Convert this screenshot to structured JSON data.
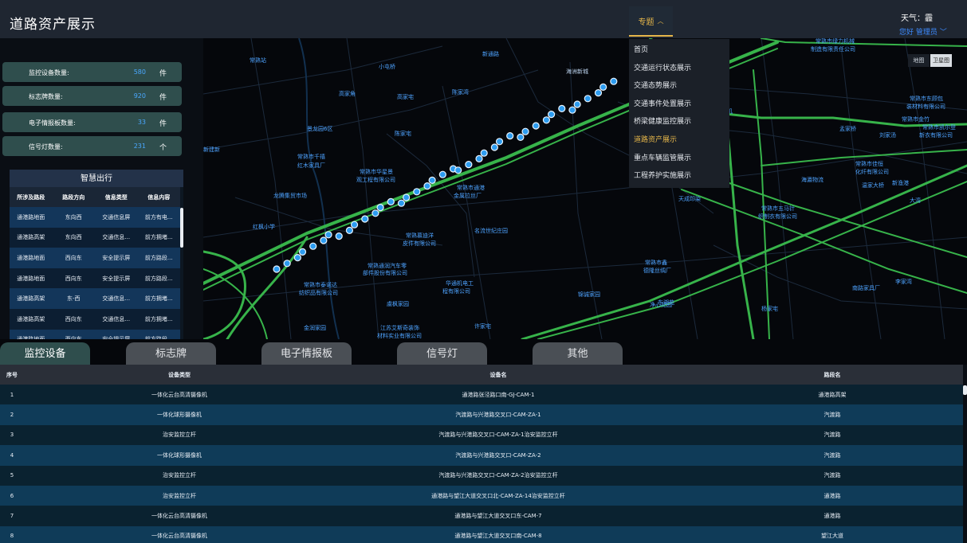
{
  "header": {
    "title": "道路资产展示",
    "menu_label": "专题",
    "weather": "天气：霾",
    "user": "您好 管理员"
  },
  "menu": {
    "items": [
      "首页",
      "交通运行状态展示",
      "交通态势展示",
      "交通事件处置展示",
      "桥梁健康监控展示",
      "道路资产展示",
      "重点车辆监管展示",
      "工程养护实施展示"
    ],
    "active_index": 5,
    "active_color": "#e5b64a"
  },
  "map": {
    "toggle": [
      "地图",
      "卫星图"
    ],
    "labels": [
      {
        "text": "常熟站",
        "c": "b"
      },
      {
        "text": "小屯桥",
        "c": "b"
      },
      {
        "text": "高家角",
        "c": "b"
      },
      {
        "text": "高家宅",
        "c": "b"
      },
      {
        "text": "陈家湾",
        "c": "b"
      },
      {
        "text": "海洲新城",
        "c": "w"
      },
      {
        "text": "常熟市绿力机械",
        "c": "b"
      },
      {
        "text": "制造有限责任公司",
        "c": "b"
      },
      {
        "text": "常熟市东顾包",
        "c": "b"
      },
      {
        "text": "装材料有限公司",
        "c": "b"
      },
      {
        "text": "常熟市凯尔登",
        "c": "b"
      },
      {
        "text": "新衣有限公司",
        "c": "b"
      },
      {
        "text": "海瀛电机",
        "c": "b"
      },
      {
        "text": "景龙园6区",
        "c": "b"
      },
      {
        "text": "常熟市千禧",
        "c": "b"
      },
      {
        "text": "红木家具厂",
        "c": "b"
      },
      {
        "text": "常熟市华星景",
        "c": "b"
      },
      {
        "text": "观工程有限公司",
        "c": "b"
      },
      {
        "text": "常熟市通港",
        "c": "b"
      },
      {
        "text": "金属拉丝厂",
        "c": "b"
      },
      {
        "text": "龙腾集贸市场",
        "c": "b"
      },
      {
        "text": "红枫小学",
        "c": "b"
      },
      {
        "text": "常熟慕迪洋",
        "c": "b"
      },
      {
        "text": "皮件有限公司",
        "c": "b"
      },
      {
        "text": "名流世纪庄园",
        "c": "b"
      },
      {
        "text": "常熟通润汽车零",
        "c": "b"
      },
      {
        "text": "部件股份有限公司",
        "c": "b"
      },
      {
        "text": "常熟市泰诺达",
        "c": "b"
      },
      {
        "text": "纺织品有限公司",
        "c": "b"
      },
      {
        "text": "华通机电工",
        "c": "b"
      },
      {
        "text": "程有限公司",
        "c": "b"
      },
      {
        "text": "虞枫家园",
        "c": "b"
      },
      {
        "text": "金润家园",
        "c": "b"
      },
      {
        "text": "江苏艾斯奇装饰",
        "c": "b"
      },
      {
        "text": "材料实业有限公司",
        "c": "b"
      },
      {
        "text": "天成印染",
        "c": "b"
      },
      {
        "text": "常熟市五马针",
        "c": "b"
      },
      {
        "text": "织制衣有限公司",
        "c": "b"
      },
      {
        "text": "常熟市鑫",
        "c": "b"
      },
      {
        "text": "德隆丝绸厂",
        "c": "b"
      },
      {
        "text": "锦诚家园",
        "c": "b"
      },
      {
        "text": "净心花园",
        "c": "b"
      },
      {
        "text": "南路家具厂",
        "c": "b"
      },
      {
        "text": "李家湾",
        "c": "b"
      },
      {
        "text": "孟家桥",
        "c": "b"
      },
      {
        "text": "常熟市佳恒",
        "c": "b"
      },
      {
        "text": "化纤有限公司",
        "c": "b"
      },
      {
        "text": "海瀛物流",
        "c": "b"
      },
      {
        "text": "常熟市金竹",
        "c": "b"
      },
      {
        "text": "温家大桥",
        "c": "b"
      },
      {
        "text": "刘家汤",
        "c": "b"
      },
      {
        "text": "新渔港",
        "c": "b"
      },
      {
        "text": "金孔桥",
        "c": "b"
      },
      {
        "text": "大湾",
        "c": "b"
      },
      {
        "text": "新通路",
        "c": "b"
      },
      {
        "text": "陈家宅",
        "c": "b"
      },
      {
        "text": "杨家宅",
        "c": "b"
      },
      {
        "text": "许家宅",
        "c": "b"
      },
      {
        "text": "新建新",
        "c": "b"
      },
      {
        "text": "东湖苑",
        "c": "b"
      }
    ]
  },
  "stats": [
    {
      "label": "监控设备数量:",
      "value": "580",
      "unit": "件"
    },
    {
      "label": "标志牌数量:",
      "value": "920",
      "unit": "件"
    },
    {
      "label": "电子情报板数量:",
      "value": "33",
      "unit": "件"
    },
    {
      "label": "信号灯数量:",
      "value": "231",
      "unit": "个"
    }
  ],
  "smart": {
    "title": "智慧出行",
    "headers": [
      "所涉及路段",
      "路段方向",
      "信息类型",
      "信息内容"
    ],
    "rows": [
      [
        "通港路地面",
        "东向西",
        "交通信息屏",
        "前方有电..."
      ],
      [
        "通港路高架",
        "东向西",
        "交通信息...",
        "前方拥堵..."
      ],
      [
        "通港路地面",
        "西向东",
        "安全提示屏",
        "前方路段..."
      ],
      [
        "通港路地面",
        "西向东",
        "安全提示屏",
        "前方路段..."
      ],
      [
        "通港路高架",
        "东-西",
        "交通信息...",
        "前方拥堵..."
      ],
      [
        "通港路高架",
        "西向东",
        "交通信息...",
        "前方拥堵..."
      ],
      [
        "通港路地面",
        "西向东",
        "安全提示屏",
        "前方路段..."
      ]
    ]
  },
  "tabs": [
    {
      "label": "监控设备",
      "active": true
    },
    {
      "label": "标志牌",
      "active": false
    },
    {
      "label": "电子情报板",
      "active": false
    },
    {
      "label": "信号灯",
      "active": false
    },
    {
      "label": "其他",
      "active": false
    }
  ],
  "device_table": {
    "headers": [
      "序号",
      "设备类型",
      "设备名",
      "路段名"
    ],
    "rows": [
      [
        "1",
        "一体化云台高清摄像机",
        "通港路张泾路口南-GJ-CAM-1",
        "通港路高架"
      ],
      [
        "2",
        "一体化球形摄像机",
        "汽渡路与兴港路交叉口-CAM-ZA-1",
        "汽渡路"
      ],
      [
        "3",
        "治安监控立杆",
        "汽渡路与兴港路交叉口-CAM-ZA-1治安监控立杆",
        "汽渡路"
      ],
      [
        "4",
        "一体化球形摄像机",
        "汽渡路与兴港路交叉口-CAM-ZA-2",
        "汽渡路"
      ],
      [
        "5",
        "治安监控立杆",
        "汽渡路与兴港路交叉口-CAM-ZA-2治安监控立杆",
        "汽渡路"
      ],
      [
        "6",
        "治安监控立杆",
        "通港路与望江大道交叉口北-CAM-ZA-14治安监控立杆",
        "通港路"
      ],
      [
        "7",
        "一体化云台高清摄像机",
        "通港路与望江大道交叉口东-CAM-7",
        "通港路"
      ],
      [
        "8",
        "一体化云台高清摄像机",
        "通港路与望江大道交叉口南-CAM-8",
        "望江大道"
      ]
    ]
  }
}
